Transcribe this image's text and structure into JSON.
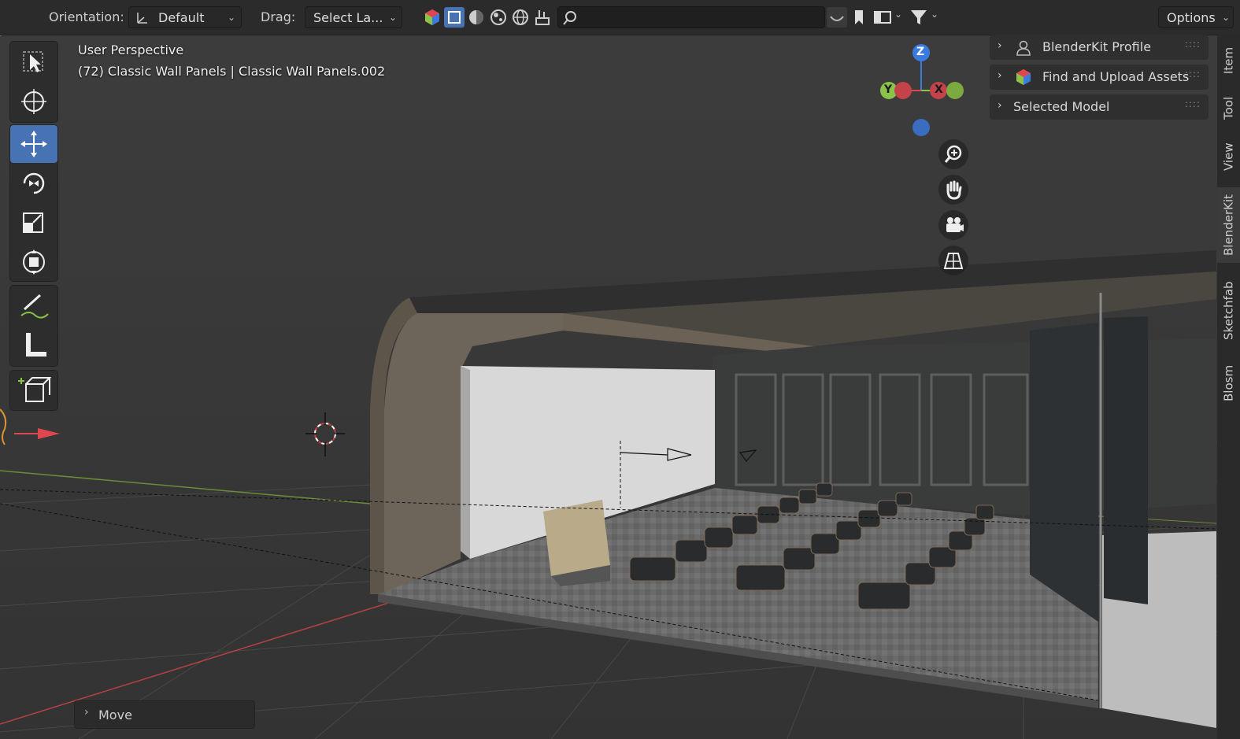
{
  "header": {
    "orientation_label": "Orientation:",
    "orientation_value": "Default",
    "drag_label": "Drag:",
    "drag_value": "Select La...",
    "options_label": "Options"
  },
  "viewport": {
    "view_name": "User Perspective",
    "object_info": "(72) Classic Wall Panels | Classic Wall Panels.002"
  },
  "gizmo": {
    "z": "Z",
    "y": "Y",
    "x": "X"
  },
  "panels": [
    {
      "label": "BlenderKit Profile"
    },
    {
      "label": "Find and Upload Assets"
    },
    {
      "label": "Selected Model"
    }
  ],
  "sidebar_tabs": [
    "Item",
    "Tool",
    "View",
    "BlenderKit",
    "Sketchfab",
    "Blosm"
  ],
  "operator_panel": {
    "label": "Move"
  },
  "colors": {
    "accent": "#4772b3",
    "x_axis": "#e0464f",
    "y_axis": "#8bc34a",
    "z_axis": "#3b7be0"
  }
}
